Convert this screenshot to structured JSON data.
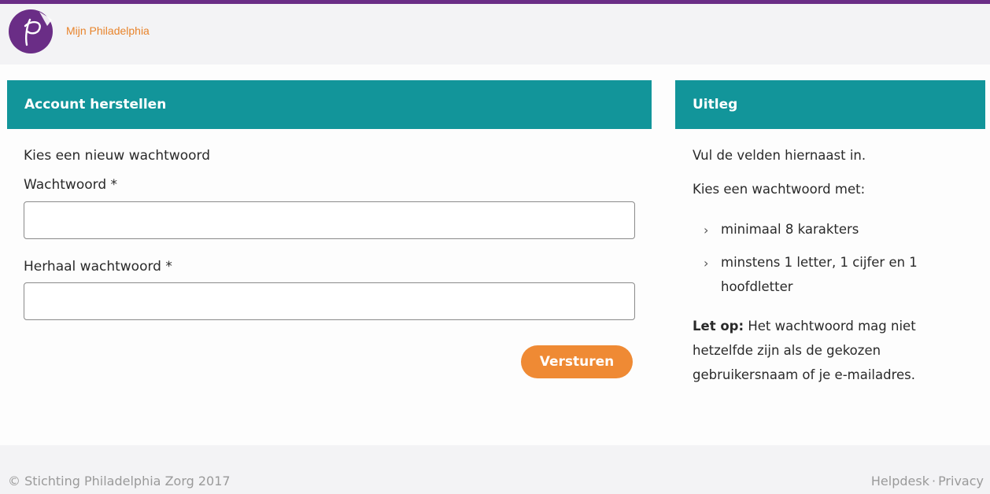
{
  "header": {
    "brand": "Mijn Philadelphia"
  },
  "left_panel": {
    "title": "Account herstellen",
    "intro": "Kies een nieuw wachtwoord",
    "password_label": "Wachtwoord *",
    "password_value": "",
    "repeat_label": "Herhaal wachtwoord *",
    "repeat_value": "",
    "submit_label": "Versturen"
  },
  "right_panel": {
    "title": "Uitleg",
    "line1": "Vul de velden hiernaast in.",
    "line2": "Kies een wachtwoord met:",
    "bullets": [
      {
        "line1": "minimaal 8 karakters"
      },
      {
        "line1": "minstens 1 letter, 1 cijfer en 1",
        "line2": "hoofdletter"
      }
    ],
    "note_bold": "Let op:",
    "note_line1": " Het wachtwoord mag niet",
    "note_line2": "hetzelfde zijn als de gekozen",
    "note_line3": "gebruikersnaam of je e-mailadres."
  },
  "footer": {
    "copyright": "© Stichting Philadelphia Zorg 2017",
    "helpdesk": "Helpdesk",
    "separator": "·",
    "privacy": "Privacy"
  },
  "colors": {
    "brand_purple": "#6a2d86",
    "teal": "#12959a",
    "orange": "#ef8a34"
  }
}
